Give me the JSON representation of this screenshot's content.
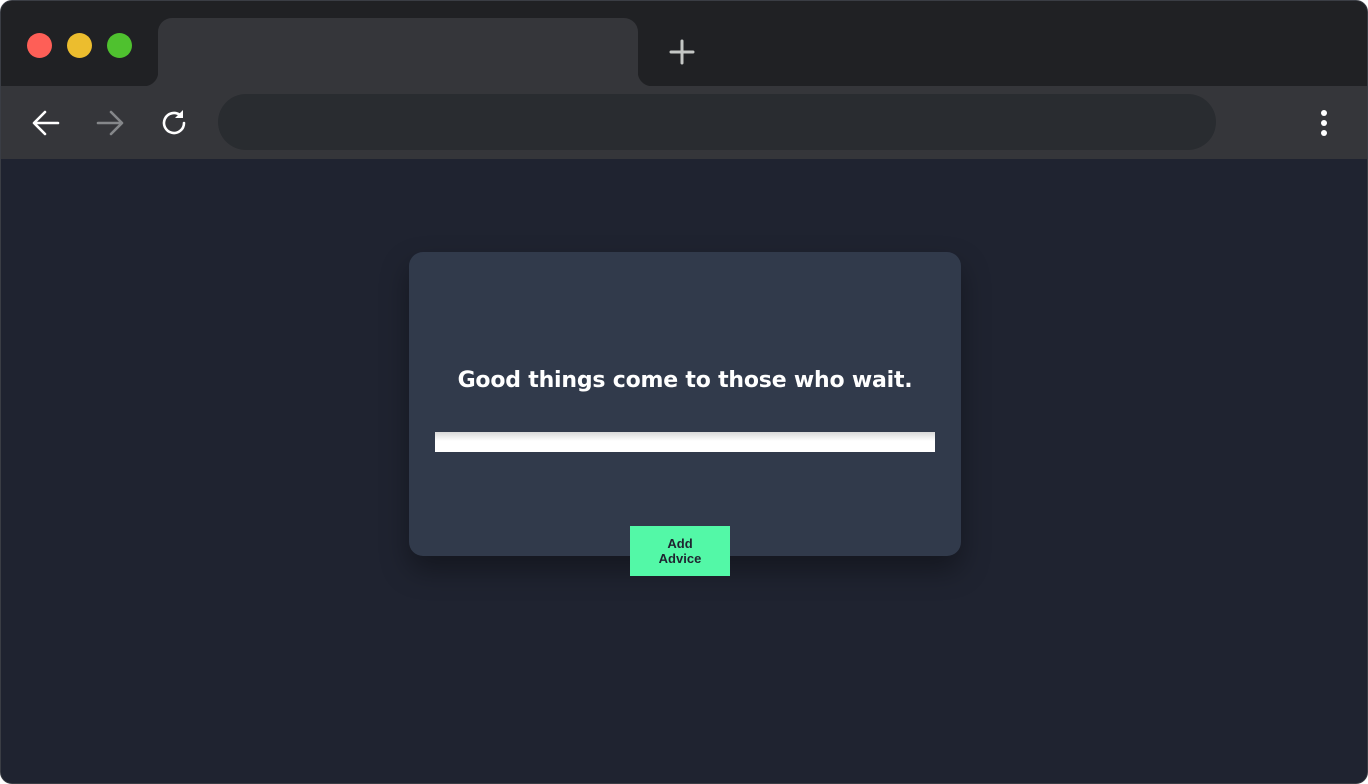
{
  "browser": {
    "tab_title": "",
    "address_bar": {
      "value": "",
      "placeholder": ""
    },
    "icons": {
      "back": "arrow-left-icon",
      "forward": "arrow-right-icon",
      "reload": "reload-icon",
      "new_tab": "plus-icon",
      "menu": "kebab-menu-icon"
    },
    "colors": {
      "close": "#fe5f57",
      "minimize": "#ecbd2e",
      "maximize": "#4fc12f",
      "tab_strip": "#202124",
      "toolbar": "#35363a"
    }
  },
  "page": {
    "advice": "Good things come to those who wait.",
    "add_button_label": "Add Advice",
    "colors": {
      "background": "#1f2330",
      "card": "#313a4b",
      "button": "#53f8a7"
    }
  }
}
